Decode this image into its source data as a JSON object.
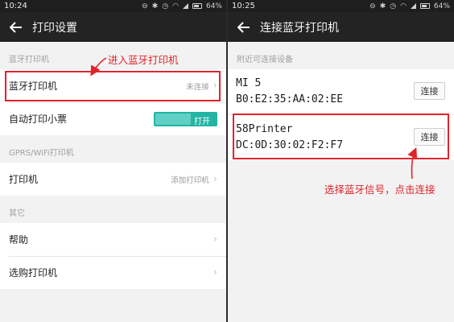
{
  "left_screen": {
    "status": {
      "time": "10:24",
      "battery": "64%"
    },
    "toolbar": {
      "title": "打印设置"
    },
    "sections": [
      {
        "header": "蓝牙打印机",
        "rows": [
          {
            "label": "蓝牙打印机",
            "value": "未连接"
          },
          {
            "label": "自动打印小票",
            "toggle_text": "打开",
            "toggle_on": true
          }
        ]
      },
      {
        "header": "GPRS/WiFi打印机",
        "rows": [
          {
            "label": "打印机",
            "value": "添加打印机"
          }
        ]
      },
      {
        "header": "其它",
        "rows": [
          {
            "label": "帮助"
          },
          {
            "label": "选购打印机"
          }
        ]
      }
    ],
    "annotation": "进入蓝牙打印机"
  },
  "right_screen": {
    "status": {
      "time": "10:25",
      "battery": "64%"
    },
    "toolbar": {
      "title": "连接蓝牙打印机"
    },
    "section_header": "附近可连接设备",
    "devices": [
      {
        "name": "MI 5",
        "mac": "B0:E2:35:AA:02:EE",
        "button": "连接"
      },
      {
        "name": "58Printer",
        "mac": "DC:0D:30:02:F2:F7",
        "button": "连接"
      }
    ],
    "annotation": "选择蓝牙信号，点击连接"
  },
  "colors": {
    "accent_toggle": "#24b4a3",
    "annotation_red": "#e2232a",
    "toolbar": "#232323"
  },
  "icons": [
    "back-arrow-icon",
    "chevron-right-icon",
    "bluetooth-icon",
    "wifi-icon",
    "signal-icon",
    "battery-icon"
  ]
}
